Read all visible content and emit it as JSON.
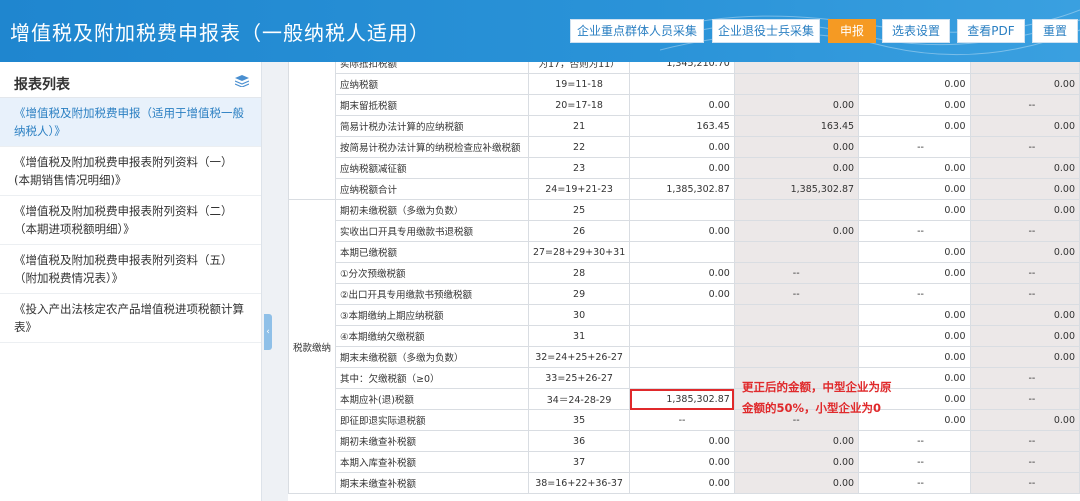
{
  "header": {
    "title": "增值税及附加税费申报表（一般纳税人适用）",
    "buttons": [
      "企业重点群体人员采集",
      "企业退役士兵采集",
      "申报",
      "选表设置",
      "查看PDF",
      "重置"
    ]
  },
  "sidebar": {
    "title": "报表列表",
    "items": [
      "《增值税及附加税费申报（适用于增值税一般纳税人）》",
      "《增值税及附加税费申报表附列资料（一）(本期销售情况明细)》",
      "《增值税及附加税费申报表附列资料（二）（本期进项税额明细）》",
      "《增值税及附加税费申报表附列资料（五）（附加税费情况表）》",
      "《投入产出法核定农产品增值税进项税额计算表》"
    ]
  },
  "table": {
    "category_label": "税款缴纳",
    "top_partial_line": "为17，否则为11）",
    "top_partial_value": "1,345,210.70",
    "rows": [
      {
        "item": "应纳税额",
        "line": "19=11-18",
        "c1": "",
        "c2": "",
        "c3": "0.00",
        "c4": "0.00"
      },
      {
        "item": "期末留抵税额",
        "line": "20=17-18",
        "c1": "0.00",
        "c2": "0.00",
        "c3": "0.00",
        "c4": "--"
      },
      {
        "item": "简易计税办法计算的应纳税额",
        "line": "21",
        "c1": "163.45",
        "c2": "163.45",
        "c3": "0.00",
        "c4": "0.00"
      },
      {
        "item": "按简易计税办法计算的纳税检查应补缴税额",
        "line": "22",
        "c1": "0.00",
        "c2": "0.00",
        "c3": "--",
        "c4": "--"
      },
      {
        "item": "应纳税额减征额",
        "line": "23",
        "c1": "0.00",
        "c2": "0.00",
        "c3": "0.00",
        "c4": "0.00"
      },
      {
        "item": "应纳税额合计",
        "line": "24=19+21-23",
        "c1": "1,385,302.87",
        "c2": "1,385,302.87",
        "c3": "0.00",
        "c4": "0.00"
      },
      {
        "item": "期初未缴税额（多缴为负数）",
        "line": "25",
        "c1": "",
        "c2": "",
        "c3": "0.00",
        "c4": "0.00"
      },
      {
        "item": "实收出口开具专用缴款书退税额",
        "line": "26",
        "c1": "0.00",
        "c2": "0.00",
        "c3": "--",
        "c4": "--"
      },
      {
        "item": "本期已缴税额",
        "line": "27=28+29+30+31",
        "c1": "",
        "c2": "",
        "c3": "0.00",
        "c4": "0.00"
      },
      {
        "item": "①分次预缴税额",
        "line": "28",
        "c1": "0.00",
        "c2": "--",
        "c3": "0.00",
        "c4": "--"
      },
      {
        "item": "②出口开具专用缴款书预缴税额",
        "line": "29",
        "c1": "0.00",
        "c2": "--",
        "c3": "--",
        "c4": "--"
      },
      {
        "item": "③本期缴纳上期应纳税额",
        "line": "30",
        "c1": "",
        "c2": "",
        "c3": "0.00",
        "c4": "0.00"
      },
      {
        "item": "④本期缴纳欠缴税额",
        "line": "31",
        "c1": "",
        "c2": "",
        "c3": "0.00",
        "c4": "0.00"
      },
      {
        "item": "期末未缴税额（多缴为负数）",
        "line": "32=24+25+26-27",
        "c1": "",
        "c2": "",
        "c3": "0.00",
        "c4": "0.00"
      },
      {
        "item": "其中：欠缴税额（≥0）",
        "line": "33=25+26-27",
        "c1": "",
        "c2": "",
        "c3": "0.00",
        "c4": "--"
      },
      {
        "item": "本期应补(退)税额",
        "line": "34＝24-28-29",
        "c1": "1,385,302.87",
        "c2": "",
        "c3": "0.00",
        "c4": "--"
      },
      {
        "item": "即征即退实际退税额",
        "line": "35",
        "c1": "--",
        "c2": "--",
        "c3": "0.00",
        "c4": "0.00"
      },
      {
        "item": "期初未缴查补税额",
        "line": "36",
        "c1": "0.00",
        "c2": "0.00",
        "c3": "--",
        "c4": "--"
      },
      {
        "item": "本期入库查补税额",
        "line": "37",
        "c1": "0.00",
        "c2": "0.00",
        "c3": "--",
        "c4": "--"
      },
      {
        "item": "期末未缴查补税额",
        "line": "38=16+22+36-37",
        "c1": "0.00",
        "c2": "0.00",
        "c3": "--",
        "c4": "--"
      }
    ]
  },
  "annotation": "更正后的金额，中型企业为原金额的50%，小型企业为0"
}
